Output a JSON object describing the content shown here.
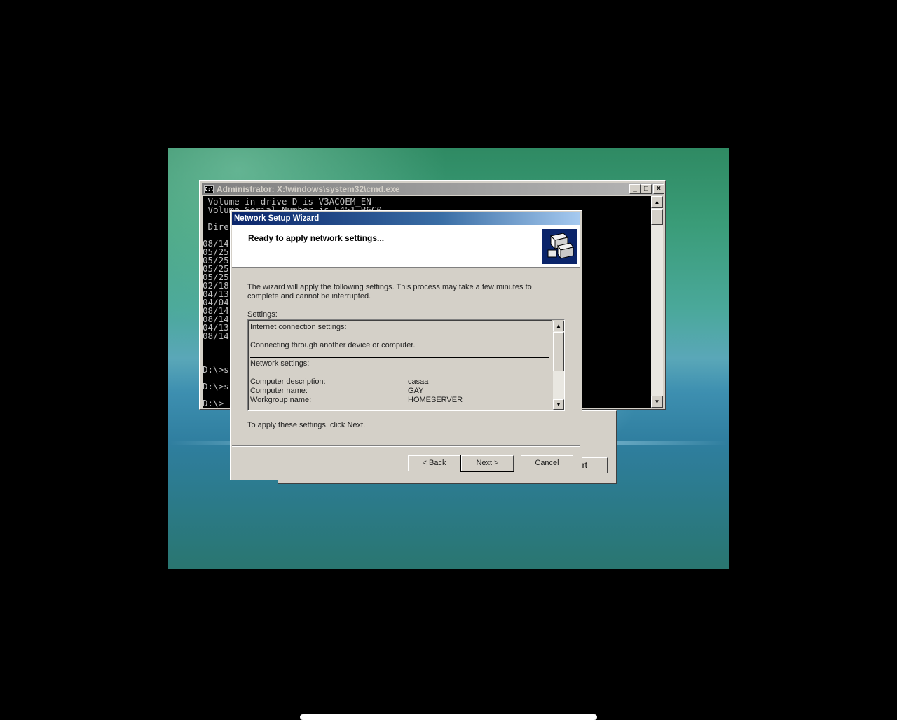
{
  "console": {
    "title": "Administrator: X:\\windows\\system32\\cmd.exe",
    "lines": [
      " Volume in drive D is V3ACOEM_EN",
      " Volume Serial Number is E451-B6C0",
      "",
      " Dire",
      "",
      "08/14",
      "05/25",
      "05/25",
      "05/25",
      "05/25",
      "02/18",
      "04/13",
      "04/04",
      "08/14",
      "08/14",
      "04/13",
      "08/14",
      "",
      "",
      "",
      "D:\\>s",
      "",
      "D:\\>s",
      "",
      "D:\\>"
    ],
    "minimize_glyph": "_",
    "maximize_glyph": "□",
    "close_glyph": "×",
    "scroll_up_glyph": "▲",
    "scroll_down_glyph": "▼"
  },
  "back_dialog": {
    "partial_button_label": "art"
  },
  "wizard": {
    "title": "Network Setup Wizard",
    "header_title": "Ready to apply network settings...",
    "header_icon": "network-computers-icon",
    "intro": "The wizard will apply the following settings. This process may take a few minutes to complete and cannot be interrupted.",
    "settings_label": "Settings:",
    "settings": {
      "internet_heading": "Internet connection settings:",
      "internet_value": "Connecting through another device or computer.",
      "network_heading": "Network settings:",
      "rows": [
        {
          "label": "Computer description:",
          "value": "casaa"
        },
        {
          "label": "Computer name:",
          "value": "GAY"
        },
        {
          "label": "Workgroup name:",
          "value": "HOMESERVER"
        }
      ]
    },
    "apply_note": "To apply these settings, click Next.",
    "buttons": {
      "back": "< Back",
      "next": "Next >",
      "cancel": "Cancel"
    }
  }
}
